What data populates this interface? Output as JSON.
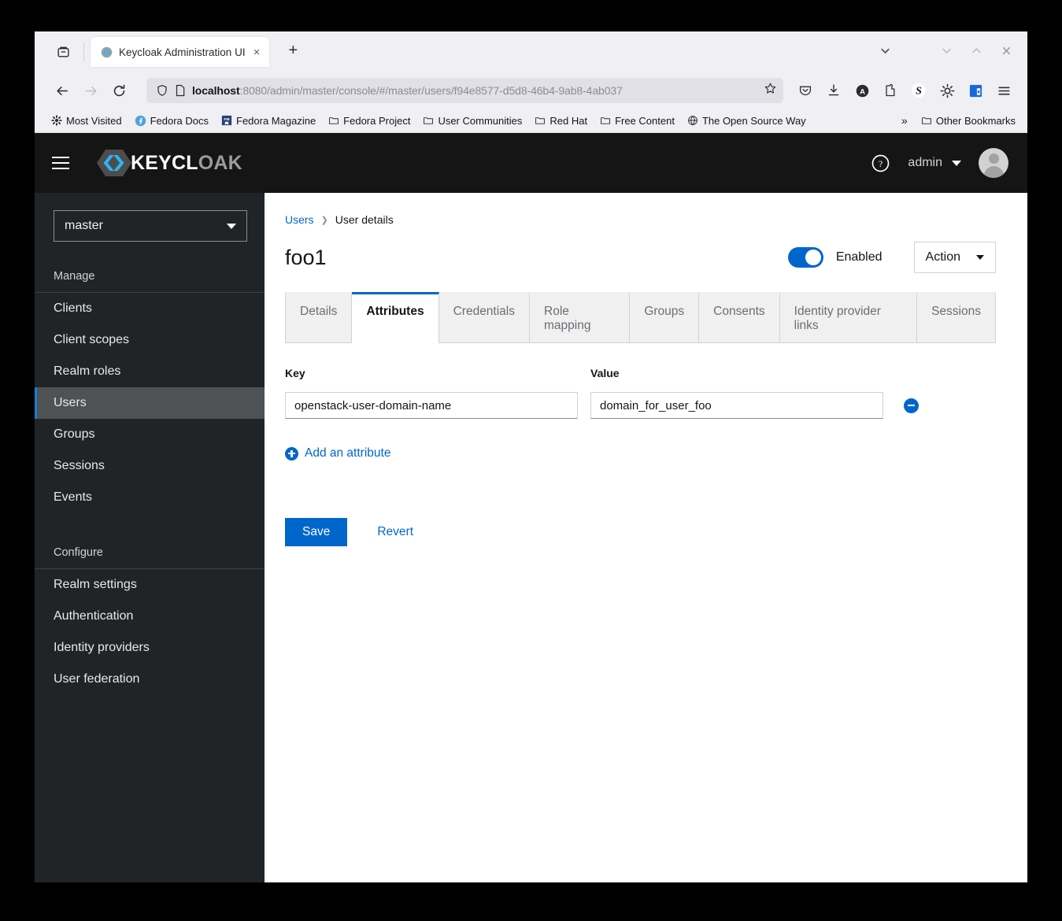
{
  "browser": {
    "tab": {
      "title": "Keycloak Administration UI",
      "favicon": "keycloak-favicon",
      "close_label": "×"
    },
    "new_tab_label": "+",
    "url": {
      "host": "localhost",
      "rest": ":8080/admin/master/console/#/master/users/f94e8577-d5d8-46b4-9ab8-4ab037"
    },
    "window_controls": {
      "list_tabs": "∨",
      "minimize": "∨",
      "maximize": "∧",
      "close": "×"
    },
    "toolbar_icons": [
      "pocket-icon",
      "downloads-icon",
      "account-icon",
      "extensions-icon",
      "s-extension-icon",
      "gear-extension-icon",
      "password-manager-icon",
      "app-menu-icon"
    ],
    "bookmarks": [
      {
        "label": "Most Visited",
        "icon": "gear-icon"
      },
      {
        "label": "Fedora Docs",
        "icon": "fedora-icon"
      },
      {
        "label": "Fedora Magazine",
        "icon": "magazine-icon"
      },
      {
        "label": "Fedora Project",
        "icon": "folder-icon"
      },
      {
        "label": "User Communities",
        "icon": "folder-icon"
      },
      {
        "label": "Red Hat",
        "icon": "folder-icon"
      },
      {
        "label": "Free Content",
        "icon": "folder-icon"
      },
      {
        "label": "The Open Source Way",
        "icon": "globe-icon"
      }
    ],
    "bookmarks_overflow": "»",
    "other_bookmarks": {
      "label": "Other Bookmarks",
      "icon": "folder-icon"
    }
  },
  "header": {
    "menu_icon": "hamburger-icon",
    "logo": {
      "key": "KEYCL",
      "oak": "OAK"
    },
    "help_icon": "help-circle-icon",
    "username": "admin",
    "avatar": "user-avatar"
  },
  "sidebar": {
    "realm": "master",
    "sections": [
      {
        "label": "Manage",
        "items": [
          {
            "label": "Clients",
            "active": false
          },
          {
            "label": "Client scopes",
            "active": false
          },
          {
            "label": "Realm roles",
            "active": false
          },
          {
            "label": "Users",
            "active": true
          },
          {
            "label": "Groups",
            "active": false
          },
          {
            "label": "Sessions",
            "active": false
          },
          {
            "label": "Events",
            "active": false
          }
        ]
      },
      {
        "label": "Configure",
        "items": [
          {
            "label": "Realm settings",
            "active": false
          },
          {
            "label": "Authentication",
            "active": false
          },
          {
            "label": "Identity providers",
            "active": false
          },
          {
            "label": "User federation",
            "active": false
          }
        ]
      }
    ]
  },
  "main": {
    "breadcrumb": {
      "parent": "Users",
      "separator": "❯",
      "current": "User details"
    },
    "page_title": "foo1",
    "enabled_toggle": {
      "label": "Enabled",
      "on": true
    },
    "action_button": {
      "label": "Action"
    },
    "tabs": [
      {
        "label": "Details",
        "active": false
      },
      {
        "label": "Attributes",
        "active": true
      },
      {
        "label": "Credentials",
        "active": false
      },
      {
        "label": "Role mapping",
        "active": false
      },
      {
        "label": "Groups",
        "active": false
      },
      {
        "label": "Consents",
        "active": false
      },
      {
        "label": "Identity provider links",
        "active": false
      },
      {
        "label": "Sessions",
        "active": false
      }
    ],
    "attributes": {
      "key_header": "Key",
      "value_header": "Value",
      "rows": [
        {
          "key": "openstack-user-domain-name",
          "value": "domain_for_user_foo"
        }
      ],
      "add_label": "Add an attribute",
      "remove_icon": "minus-circle-icon"
    },
    "buttons": {
      "save": "Save",
      "revert": "Revert"
    }
  },
  "colors": {
    "accent_blue": "#0066cc",
    "header_dark": "#151515",
    "sidebar_dark": "#212427",
    "sidebar_active": "#4f5255",
    "active_bar": "#0f83d4"
  }
}
